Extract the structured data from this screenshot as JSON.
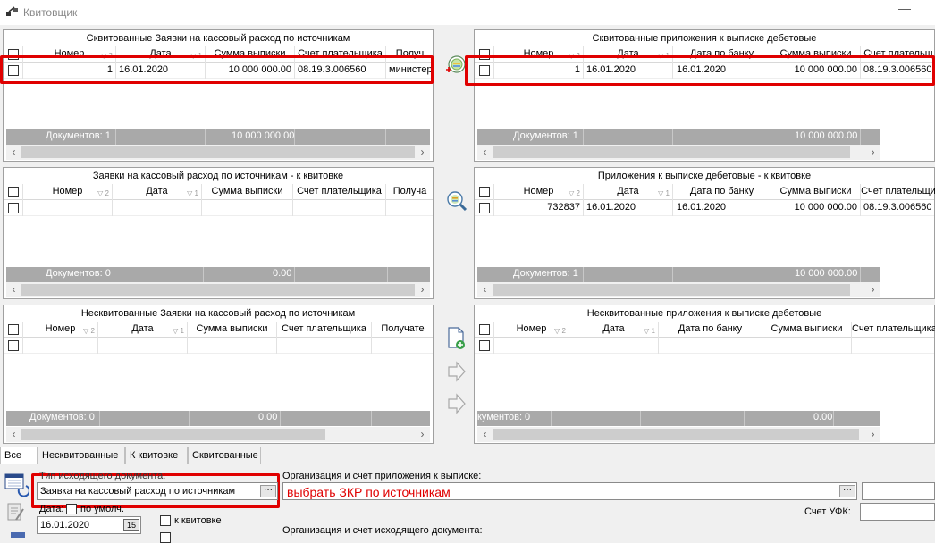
{
  "window": {
    "title": "Квитовщик",
    "minimize_glyph": "—"
  },
  "panels": {
    "tl": {
      "title": "Сквитованные Заявки на кассовый расход по источникам",
      "headers": [
        "Номер",
        "Дата",
        "Сумма выписки",
        "Счет плательщика",
        "Получ"
      ],
      "sort": [
        "▽ 2",
        "▽ 1"
      ],
      "row": [
        "1",
        "16.01.2020",
        "10 000 000.00",
        "08.19.3.006560",
        "министер"
      ],
      "footer_count": "Документов: 1",
      "footer_sum": "10 000 000.00"
    },
    "tr": {
      "title": "Сквитованные приложения к выписке дебетовые",
      "headers": [
        "Номер",
        "Дата",
        "Дата по банку",
        "Сумма выписки",
        "Счет плательщ"
      ],
      "sort": [
        "▽ 2",
        "▽ 1"
      ],
      "row": [
        "1",
        "16.01.2020",
        "16.01.2020",
        "10 000 000.00",
        "08.19.3.006560"
      ],
      "footer_count": "Документов: 1",
      "footer_sum": "10 000 000.00"
    },
    "ml": {
      "title": "Заявки на кассовый расход по источникам - к квитовке",
      "headers": [
        "Номер",
        "Дата",
        "Сумма выписки",
        "Счет плательщика",
        "Получа"
      ],
      "sort": [
        "▽ 2",
        "▽ 1"
      ],
      "footer_count": "Документов: 0",
      "footer_sum": "0.00"
    },
    "mr": {
      "title": "Приложения к выписке дебетовые - к квитовке",
      "headers": [
        "Номер",
        "Дата",
        "Дата по банку",
        "Сумма выписки",
        "Счет плательщи"
      ],
      "sort": [
        "▽ 2",
        "▽ 1"
      ],
      "row": [
        "732837",
        "16.01.2020",
        "16.01.2020",
        "10 000 000.00",
        "08.19.3.006560"
      ],
      "footer_count": "Документов: 1",
      "footer_sum": "10 000 000.00"
    },
    "bl": {
      "title": "Несквитованные Заявки на кассовый расход по источникам",
      "headers": [
        "Номер",
        "Дата",
        "Сумма выписки",
        "Счет плательщика",
        "Получате"
      ],
      "sort": [
        "▽ 2",
        "▽ 1"
      ],
      "footer_count": "Документов: 0",
      "footer_sum": "0.00"
    },
    "br": {
      "title": "Несквитованные приложения к выписке дебетовые",
      "headers": [
        "Номер",
        "Дата",
        "Дата по банку",
        "Сумма выписки",
        "Счет плательщика"
      ],
      "sort": [
        "▽ 2",
        "▽ 1"
      ],
      "footer_count": "кументов: 0",
      "footer_sum": "0.00"
    }
  },
  "tabs": [
    "Все",
    "Несквитованные",
    "К квитовке",
    "Сквитованные"
  ],
  "form": {
    "doc_type_label": "Тип исходящего документа:",
    "doc_type_value": "Заявка на кассовый расход по источникам",
    "org_label": "Организация и счет приложения к выписке:",
    "annotation": "выбрать ЗКР по источникам",
    "date_label": "Дата:",
    "default_label": "по умолч.",
    "date_value": "16.01.2020",
    "to_reconcile_label": "к квитовке",
    "ufk_label": "Счет УФК:",
    "org_src_label": "Организация и счет исходящего документа:",
    "ellipsis": "···",
    "calendar_glyph": "15"
  },
  "colors": {
    "annotation_red": "#e00000",
    "footer_gray": "#a9a9a9"
  }
}
